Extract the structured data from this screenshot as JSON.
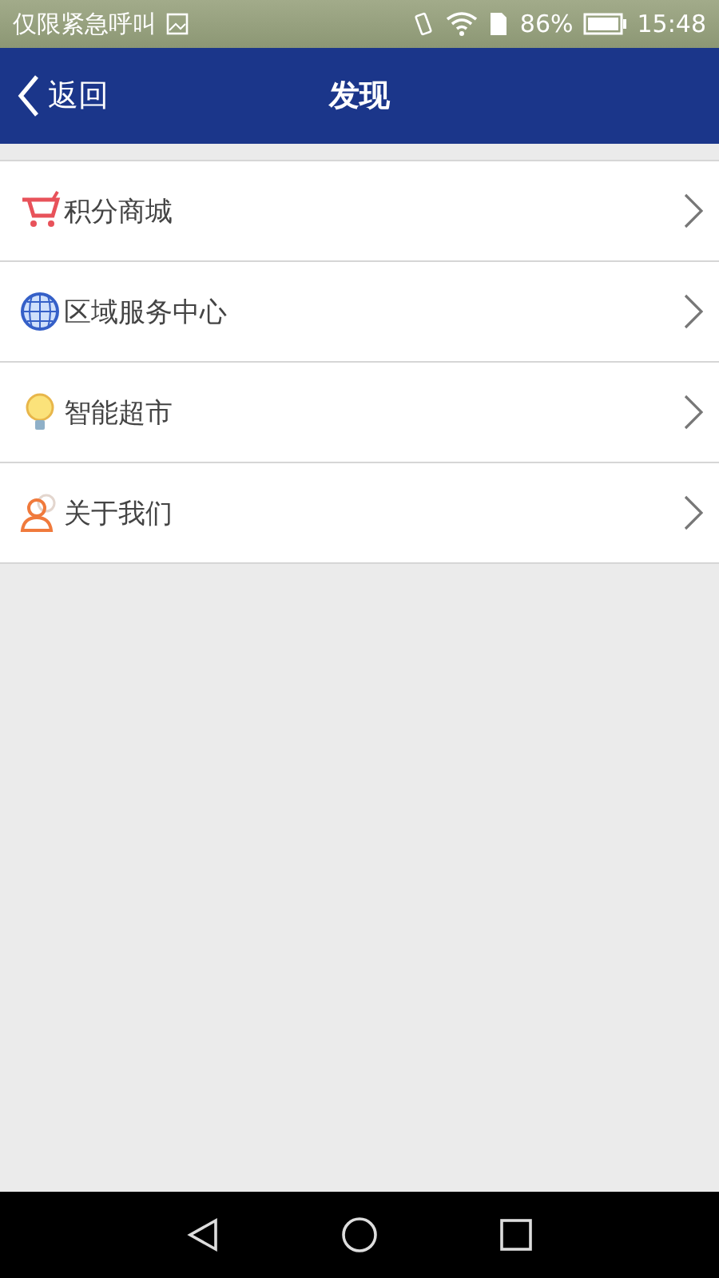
{
  "status_bar": {
    "carrier": "仅限紧急呼叫",
    "battery": "86%",
    "time": "15:48"
  },
  "header": {
    "back": "返回",
    "title": "发现"
  },
  "items": [
    {
      "kind": "cart",
      "label": "积分商城"
    },
    {
      "kind": "globe",
      "label": "区域服务中心"
    },
    {
      "kind": "bulb",
      "label": "智能超市"
    },
    {
      "kind": "person",
      "label": "关于我们"
    }
  ]
}
